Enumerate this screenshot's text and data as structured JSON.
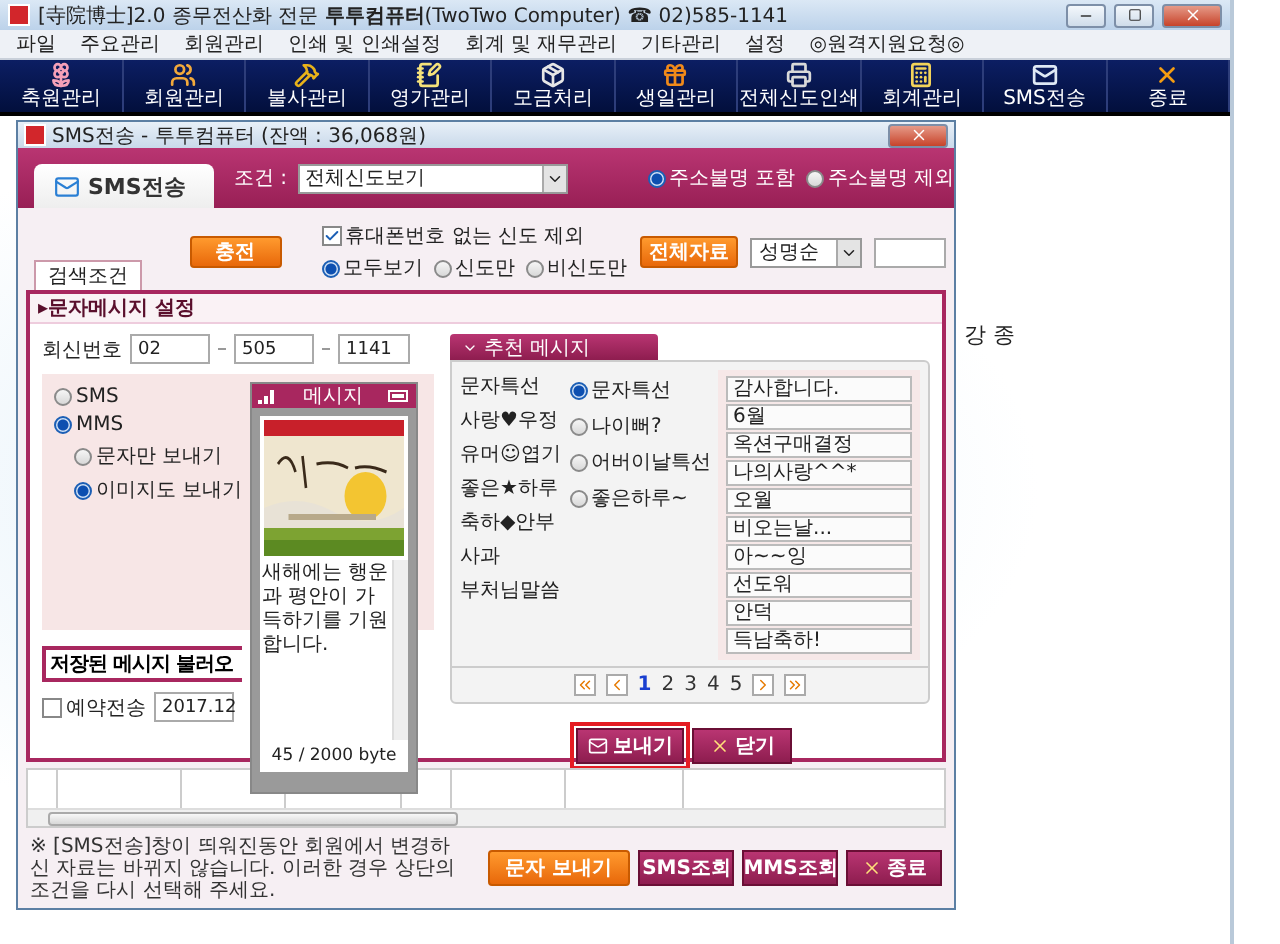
{
  "window": {
    "title": "[寺院博士]2.0 종무전산화 전문 **투투컴퓨터**(TwoTwo Computer) ☎ 02)585-1141"
  },
  "menu": [
    "파일",
    "주요관리",
    "회원관리",
    "인쇄 및 인쇄설정",
    "회계 및 재무관리",
    "기타관리",
    "설정",
    "◎원격지원요청◎"
  ],
  "toolbar": [
    "축원관리",
    "회원관리",
    "불사관리",
    "영가관리",
    "모금처리",
    "생일관리",
    "전체신도인쇄",
    "회계관리",
    "SMS전송",
    "종료"
  ],
  "background_text": [
    "강 종"
  ],
  "dialog": {
    "title": "SMS전송 - 투투컴퓨터 (잔액 : 36,068원)",
    "tab": "SMS전송",
    "condition_label": "조건 :",
    "condition_value": "전체신도보기",
    "address_options": [
      {
        "label": "주소불명 포함",
        "selected": true
      },
      {
        "label": "주소불명 제외",
        "selected": false
      }
    ],
    "search": {
      "tab": "검색조건",
      "charge_button": "충전",
      "exclude_no_phone": {
        "label": "휴대폰번호 없는 신도 제외",
        "checked": true
      },
      "filter_options": [
        {
          "label": "모두보기",
          "selected": true
        },
        {
          "label": "신도만",
          "selected": false
        },
        {
          "label": "비신도만",
          "selected": false
        }
      ],
      "all_data_button": "전체자료",
      "sort_value": "성명순"
    },
    "message_settings": {
      "title": "▸문자메시지 설정",
      "reply_label": "회신번호",
      "reply_number": [
        "02",
        "505",
        "1141"
      ],
      "type_options": [
        {
          "label": "SMS",
          "selected": false
        },
        {
          "label": "MMS",
          "selected": true
        }
      ],
      "mms_options": [
        {
          "label": "문자만 보내기",
          "selected": false
        },
        {
          "label": "이미지도 보내기",
          "selected": true
        }
      ],
      "phone": {
        "title": "메시지",
        "message": "새해에는 행운과 평안이 가득하기를 기원합니다.",
        "byte_count": "45 / 2000 byte"
      },
      "load_button": "저장된 메시지 불러오",
      "reserve": {
        "label": "예약전송",
        "checked": false
      },
      "reserve_date": "2017.12"
    },
    "recommend": {
      "title": "추천 메시지",
      "categories": [
        "문자특선",
        "사랑♥우정",
        "유머☺엽기",
        "좋은★하루",
        "축하◆안부",
        "사과",
        "부처님말씀"
      ],
      "subcategories": [
        {
          "label": "문자특선",
          "selected": true
        },
        {
          "label": "나이뻐?",
          "selected": false
        },
        {
          "label": "어버이날특선",
          "selected": false
        },
        {
          "label": "좋은하루~",
          "selected": false
        }
      ],
      "messages": [
        "감사합니다.",
        "6월",
        "옥션구매결정",
        "나의사랑^^*",
        "오월",
        "비오는날...",
        "아~~잉",
        "선도워",
        "안덕",
        "득남축하!"
      ],
      "pages": [
        {
          "label": "1",
          "selected": true
        },
        {
          "label": "2",
          "selected": false
        },
        {
          "label": "3",
          "selected": false
        },
        {
          "label": "4",
          "selected": false
        },
        {
          "label": "5",
          "selected": false
        }
      ]
    },
    "send_button": "보내기",
    "close_button": "닫기",
    "footer_note": "※ [SMS전송]창이 띄워진동안 회원에서 변경하신 자료는 바뀌지 않습니다. 이러한 경우 상단의 조건을 다시 선택해 주세요.",
    "footer_buttons": [
      "문자 보내기",
      "SMS조회",
      "MMS조회",
      "종료"
    ]
  }
}
